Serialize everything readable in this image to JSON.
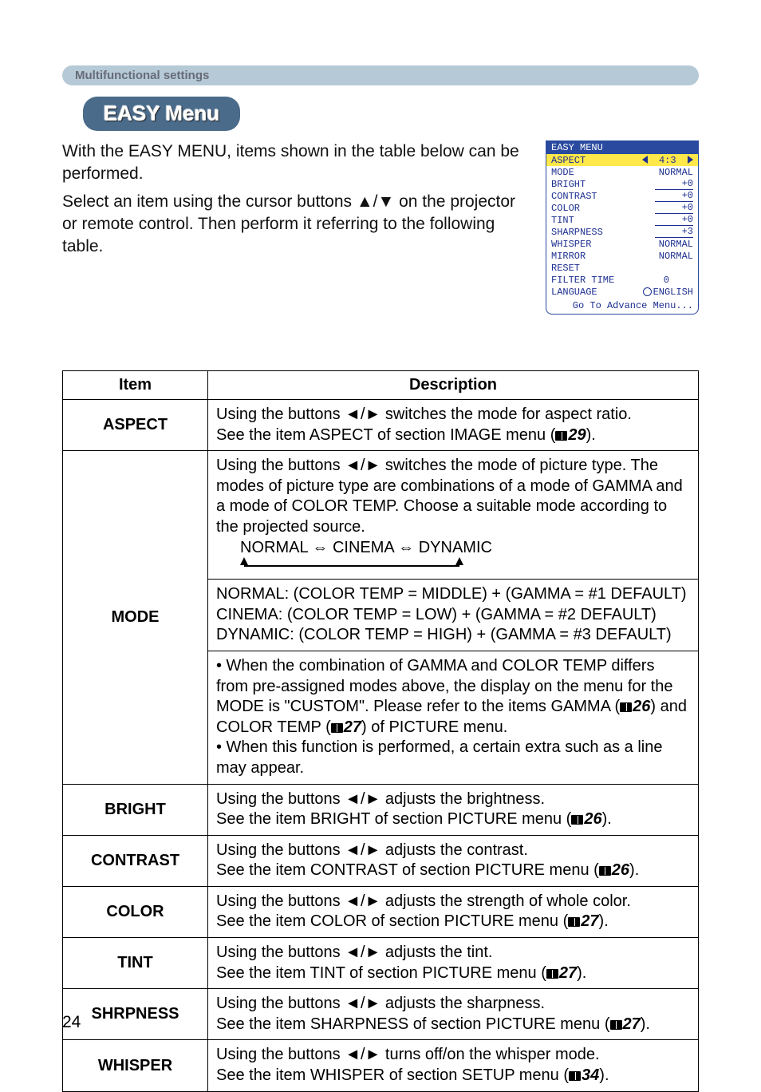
{
  "section_bar": "Multifunctional settings",
  "title": "EASY Menu",
  "intro_p1": "With the EASY MENU, items shown in the table below can be performed.",
  "intro_p2": "Select an item using the cursor buttons ▲/▼ on the projector or remote control. Then perform it referring to the following table.",
  "page_number": "24",
  "easy_menu": {
    "title": "EASY MENU",
    "rows": [
      {
        "label": "ASPECT",
        "value": "4:3",
        "selected": true,
        "arrows": true
      },
      {
        "label": "MODE",
        "value": "NORMAL"
      },
      {
        "label": "BRIGHT",
        "value": "+0",
        "bar": true
      },
      {
        "label": "CONTRAST",
        "value": "+0",
        "bar": true
      },
      {
        "label": "COLOR",
        "value": "+0",
        "bar": true
      },
      {
        "label": "TINT",
        "value": "+0",
        "bar": true
      },
      {
        "label": "SHARPNESS",
        "value": "+3",
        "bar": true
      },
      {
        "label": "WHISPER",
        "value": "NORMAL"
      },
      {
        "label": "MIRROR",
        "value": "NORMAL"
      },
      {
        "label": "RESET",
        "value": ""
      },
      {
        "label": "FILTER TIME",
        "value": "0"
      },
      {
        "label": "LANGUAGE",
        "value": "ENGLISH",
        "globe": true
      }
    ],
    "footer": "Go To Advance Menu..."
  },
  "table": {
    "headers": {
      "item": "Item",
      "desc": "Description"
    },
    "rows": {
      "aspect": {
        "item": "ASPECT",
        "line1": "Using the buttons ◄/► switches the mode for aspect ratio.",
        "line2_a": "See the item ASPECT of section IMAGE menu (",
        "line2_ref": "29",
        "line2_b": ")."
      },
      "mode": {
        "item": "MODE",
        "p1": "Using the buttons ◄/► switches the mode of picture type. The modes of picture type are combinations of a mode of GAMMA and a mode of COLOR TEMP. Choose a suitable mode according to the projected source.",
        "cycle": "NORMAL ⇔ CINEMA ⇔ DYNAMIC",
        "l1": "NORMAL: (COLOR TEMP = MIDDLE) + (GAMMA = #1 DEFAULT)",
        "l2": "CINEMA: (COLOR TEMP = LOW) + (GAMMA = #2 DEFAULT)",
        "l3": "DYNAMIC: (COLOR TEMP = HIGH) + (GAMMA = #3 DEFAULT)",
        "n1a": "• When the combination of GAMMA and COLOR TEMP differs from pre-assigned modes above, the display on the menu for the MODE is \"CUSTOM\". Please refer to the items GAMMA (",
        "n1ref1": "26",
        "n1b": ") and COLOR TEMP (",
        "n1ref2": "27",
        "n1c": ") of PICTURE menu.",
        "n2": "• When this function is performed, a certain extra such as a line may appear."
      },
      "bright": {
        "item": "BRIGHT",
        "line1": "Using the buttons ◄/► adjusts the brightness.",
        "line2_a": "See the item BRIGHT of section PICTURE menu (",
        "ref": "26",
        "line2_b": ")."
      },
      "contrast": {
        "item": "CONTRAST",
        "line1": "Using the buttons ◄/► adjusts the contrast.",
        "line2_a": "See the item CONTRAST of section PICTURE menu (",
        "ref": "26",
        "line2_b": ")."
      },
      "color": {
        "item": "COLOR",
        "line1": "Using the buttons ◄/► adjusts the strength of whole color.",
        "line2_a": "See the item COLOR of section PICTURE menu (",
        "ref": "27",
        "line2_b": ")."
      },
      "tint": {
        "item": "TINT",
        "line1": "Using the buttons ◄/► adjusts the tint.",
        "line2_a": "See the item TINT of section PICTURE menu (",
        "ref": "27",
        "line2_b": ")."
      },
      "shrpness": {
        "item": "SHRPNESS",
        "line1": "Using the buttons ◄/► adjusts the sharpness.",
        "line2_a": "See the item SHARPNESS of section PICTURE menu (",
        "ref": "27",
        "line2_b": ")."
      },
      "whisper": {
        "item": "WHISPER",
        "line1": "Using the buttons ◄/► turns off/on the whisper mode.",
        "line2_a": "See the item WHISPER of section SETUP menu (",
        "ref": "34",
        "line2_b": ")."
      }
    }
  }
}
